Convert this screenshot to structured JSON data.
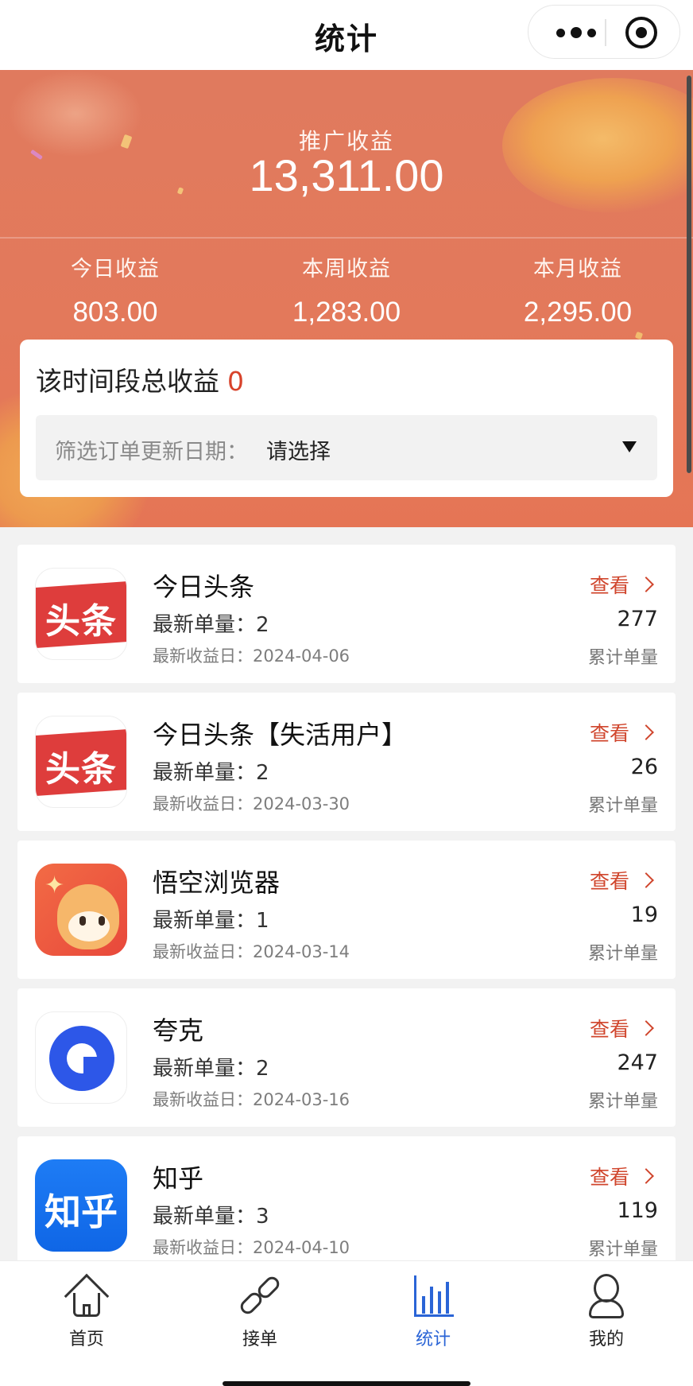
{
  "nav": {
    "title": "统计"
  },
  "summary": {
    "promo_label": "推广收益",
    "promo_value": "13,311.00",
    "today_label": "今日收益",
    "today_value": "803.00",
    "week_label": "本周收益",
    "week_value": "1,283.00",
    "month_label": "本月收益",
    "month_value": "2,295.00"
  },
  "filter": {
    "title": "该时间段总收益",
    "total": "0",
    "label": "筛选订单更新日期：",
    "value": "请选择"
  },
  "apps": [
    {
      "name": "今日头条",
      "count_label": "最新单量：",
      "count": "2",
      "date_label": "最新收益日：",
      "date": "2024-04-06",
      "view": "查看",
      "total": "277",
      "total_label": "累计单量",
      "icon": "toutiao-icon",
      "icon_text": "头条"
    },
    {
      "name": "今日头条【失活用户】",
      "count_label": "最新单量：",
      "count": "2",
      "date_label": "最新收益日：",
      "date": "2024-03-30",
      "view": "查看",
      "total": "26",
      "total_label": "累计单量",
      "icon": "toutiao-icon",
      "icon_text": "头条"
    },
    {
      "name": "悟空浏览器",
      "count_label": "最新单量：",
      "count": "1",
      "date_label": "最新收益日：",
      "date": "2024-03-14",
      "view": "查看",
      "total": "19",
      "total_label": "累计单量",
      "icon": "wukong-browser-icon"
    },
    {
      "name": "夸克",
      "count_label": "最新单量：",
      "count": "2",
      "date_label": "最新收益日：",
      "date": "2024-03-16",
      "view": "查看",
      "total": "247",
      "total_label": "累计单量",
      "icon": "quark-icon"
    },
    {
      "name": "知乎",
      "count_label": "最新单量：",
      "count": "3",
      "date_label": "最新收益日：",
      "date": "2024-04-10",
      "view": "查看",
      "total": "119",
      "total_label": "累计单量",
      "icon": "zhihu-icon",
      "icon_text": "知乎"
    }
  ],
  "tabs": {
    "home": "首页",
    "order": "接单",
    "stats": "统计",
    "mine": "我的"
  },
  "colors": {
    "accent_orange": "#e3795b",
    "highlight_red": "#d0462d",
    "active_tab": "#2a64d6"
  }
}
